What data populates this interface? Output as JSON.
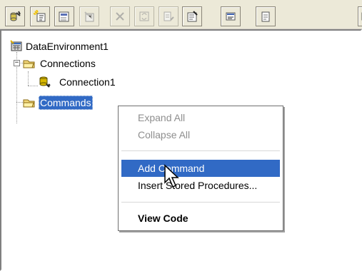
{
  "toolbar": {
    "buttons": [
      {
        "name": "add-connection-icon"
      },
      {
        "name": "add-command-icon"
      },
      {
        "name": "insert-stored-procedures-icon"
      },
      {
        "name": "add-child-command-icon"
      },
      {
        "name": "delete-icon"
      },
      {
        "name": "refresh-icon"
      },
      {
        "name": "design-icon"
      },
      {
        "name": "properties-icon"
      },
      {
        "name": "view-code-icon"
      },
      {
        "name": "data-view-icon"
      },
      {
        "name": "options-icon"
      }
    ]
  },
  "tree": {
    "root": "DataEnvironment1",
    "connections": "Connections",
    "connection1": "Connection1",
    "commands": "Commands"
  },
  "context_menu": {
    "expand_all": "Expand All",
    "collapse_all": "Collapse All",
    "add_command": "Add Command",
    "insert_stored_procedures": "Insert Stored Procedures...",
    "view_code": "View Code"
  }
}
